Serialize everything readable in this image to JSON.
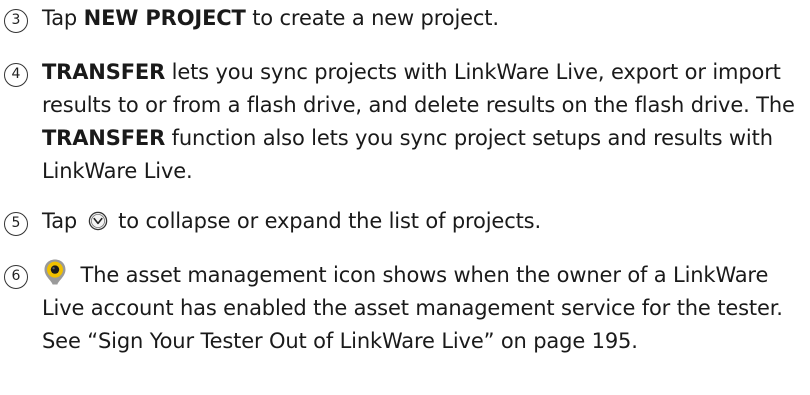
{
  "items": [
    {
      "number": "3",
      "parts": [
        "Tap ",
        "NEW PROJECT",
        " to create a new project."
      ]
    },
    {
      "number": "4",
      "parts": [
        "TRANSFER",
        " lets you sync projects with LinkWare Live, export or import results to or from a flash drive, and delete results on the flash drive. The ",
        "TRANSFER",
        " function also lets you sync project setups and results with LinkWare Live."
      ]
    },
    {
      "number": "5",
      "parts": [
        "Tap ",
        " to collapse or expand the list of projects."
      ],
      "icon": "chevron-down-circle-icon"
    },
    {
      "number": "6",
      "parts": [
        " The asset management icon shows when the owner of a LinkWare Live account has enabled the asset management service for the tester. See “Sign Your Tester Out of LinkWare Live” on page 195."
      ],
      "icon": "asset-management-icon"
    }
  ],
  "colors": {
    "text": "#1a1a1a",
    "asset_icon_outer": "#f0c000",
    "asset_icon_inner": "#1a1a1a"
  }
}
